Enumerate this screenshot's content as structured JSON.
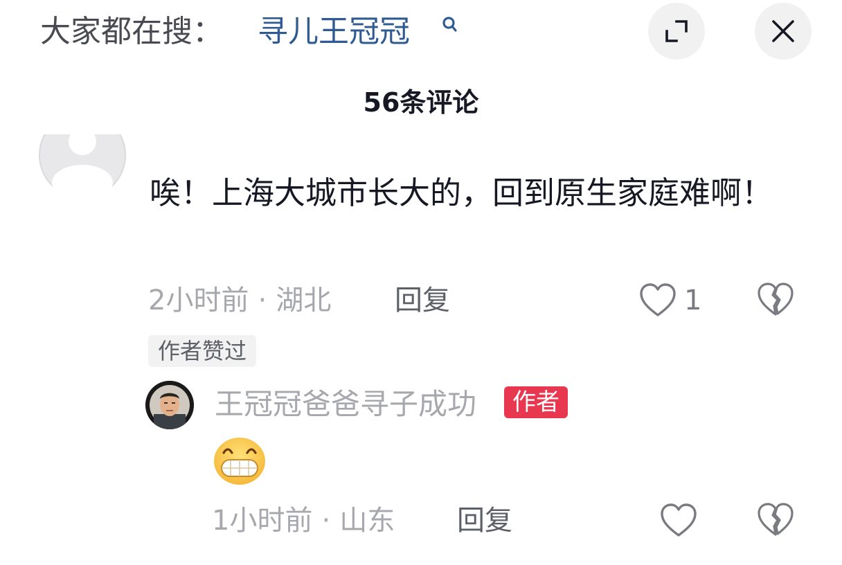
{
  "header": {
    "search_prefix": "大家都在搜：",
    "search_term": "寻儿王冠冠",
    "search_icon": "search-icon",
    "expand_icon": "expand-icon",
    "close_icon": "close-icon",
    "link_color": "#2f5b92"
  },
  "comments_title": "56条评论",
  "comments": [
    {
      "avatar": "default-avatar",
      "text": "唉！上海大城市长大的，回到原生家庭难啊！",
      "time": "2小时前",
      "separator": "·",
      "location": "湖北",
      "reply_label": "回复",
      "likes": "1",
      "tag": "作者赞过",
      "replies": [
        {
          "username": "王冠冠爸爸寻子成功",
          "badge": "作者",
          "badge_color": "#e8384f",
          "content_emoji": "grinning-face-emoji",
          "time": "1小时前",
          "separator": "·",
          "location": "山东",
          "reply_label": "回复"
        }
      ]
    }
  ]
}
